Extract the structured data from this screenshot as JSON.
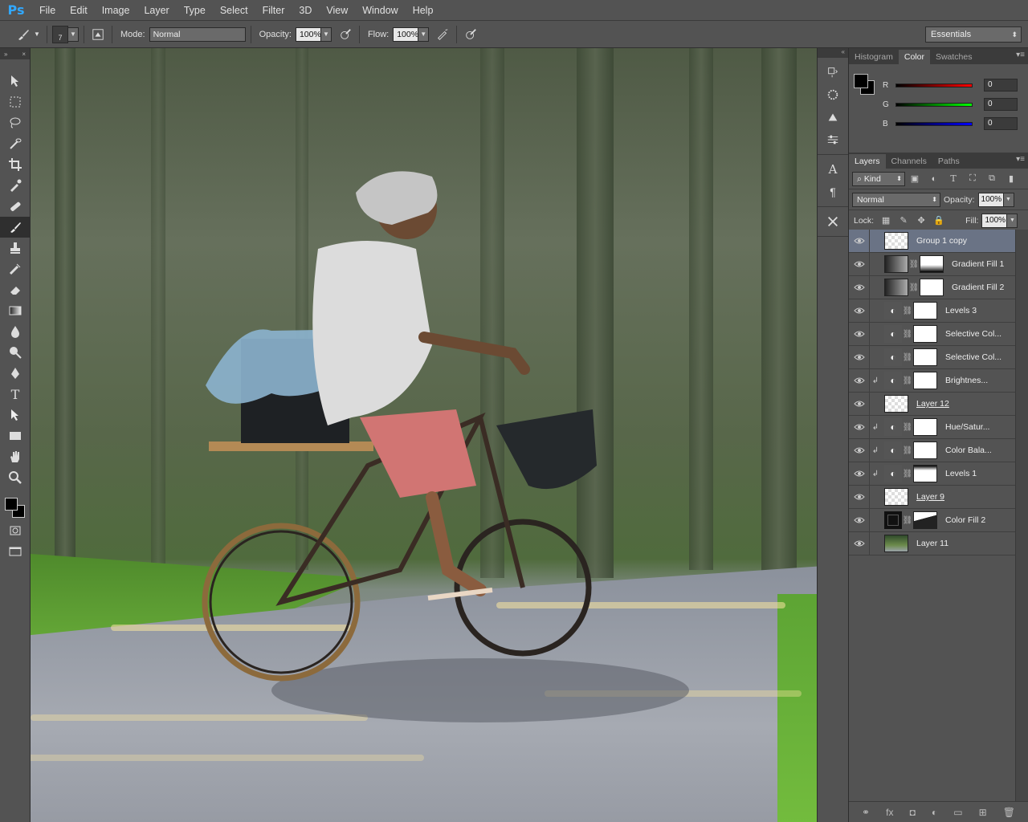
{
  "app": {
    "logo": "Ps"
  },
  "menu": [
    "File",
    "Edit",
    "Image",
    "Layer",
    "Type",
    "Select",
    "Filter",
    "3D",
    "View",
    "Window",
    "Help"
  ],
  "options": {
    "brush_size": "7",
    "mode_label": "Mode:",
    "mode_value": "Normal",
    "opacity_label": "Opacity:",
    "opacity_value": "100%",
    "flow_label": "Flow:",
    "flow_value": "100%",
    "workspace": "Essentials"
  },
  "color_panel": {
    "tabs": [
      "Histogram",
      "Color",
      "Swatches"
    ],
    "active_tab": "Color",
    "channels": [
      {
        "letter": "R",
        "value": "0",
        "color": "#ff0000"
      },
      {
        "letter": "G",
        "value": "0",
        "color": "#00ff00"
      },
      {
        "letter": "B",
        "value": "0",
        "color": "#0000ff"
      }
    ]
  },
  "layers_panel": {
    "tabs": [
      "Layers",
      "Channels",
      "Paths"
    ],
    "kind_label": "Kind",
    "blend_mode": "Normal",
    "opacity_label": "Opacity:",
    "opacity_value": "100%",
    "lock_label": "Lock:",
    "fill_label": "Fill:",
    "fill_value": "100%",
    "layers": [
      {
        "name": "Group 1 copy",
        "thumb": "checker",
        "selected": true,
        "underline": false,
        "clipped": false,
        "adjustment": false,
        "mask": ""
      },
      {
        "name": "Gradient Fill 1",
        "thumb": "gradient",
        "selected": false,
        "underline": false,
        "clipped": false,
        "adjustment": false,
        "mask": "grad"
      },
      {
        "name": "Gradient Fill 2",
        "thumb": "gradient",
        "selected": false,
        "underline": false,
        "clipped": false,
        "adjustment": false,
        "mask": "white"
      },
      {
        "name": "Levels 3",
        "thumb": "adj",
        "selected": false,
        "underline": false,
        "clipped": false,
        "adjustment": true,
        "mask": "white"
      },
      {
        "name": "Selective Col...",
        "thumb": "adj",
        "selected": false,
        "underline": false,
        "clipped": false,
        "adjustment": true,
        "mask": "white"
      },
      {
        "name": "Selective Col...",
        "thumb": "adj",
        "selected": false,
        "underline": false,
        "clipped": false,
        "adjustment": true,
        "mask": "white"
      },
      {
        "name": "Brightnes...",
        "thumb": "adj",
        "selected": false,
        "underline": false,
        "clipped": true,
        "adjustment": true,
        "mask": "white"
      },
      {
        "name": "Layer 12",
        "thumb": "checker",
        "selected": false,
        "underline": true,
        "clipped": false,
        "adjustment": false,
        "mask": ""
      },
      {
        "name": "Hue/Satur...",
        "thumb": "adj",
        "selected": false,
        "underline": false,
        "clipped": true,
        "adjustment": true,
        "mask": "white"
      },
      {
        "name": "Color Bala...",
        "thumb": "adj",
        "selected": false,
        "underline": false,
        "clipped": true,
        "adjustment": true,
        "mask": "white"
      },
      {
        "name": "Levels 1",
        "thumb": "adj",
        "selected": false,
        "underline": false,
        "clipped": true,
        "adjustment": true,
        "mask": "hill"
      },
      {
        "name": "Layer 9",
        "thumb": "checker",
        "selected": false,
        "underline": true,
        "clipped": false,
        "adjustment": false,
        "mask": ""
      },
      {
        "name": "Color Fill 2",
        "thumb": "black",
        "selected": false,
        "underline": false,
        "clipped": false,
        "adjustment": false,
        "mask": "curve"
      },
      {
        "name": "Layer 11",
        "thumb": "forest",
        "selected": false,
        "underline": false,
        "clipped": false,
        "adjustment": false,
        "mask": ""
      }
    ],
    "footer_icons": [
      "link-layers-icon",
      "fx-icon",
      "add-mask-icon",
      "adjustment-icon",
      "new-group-icon",
      "new-layer-icon",
      "trash-icon"
    ],
    "footer_glyphs": [
      "⚭",
      "fx",
      "◘",
      "◐",
      "▭",
      "⊞",
      "🗑"
    ]
  },
  "colors": {
    "accent": "#31a8ff",
    "selected_layer": "#6a7385",
    "panel_bg": "#535353"
  }
}
